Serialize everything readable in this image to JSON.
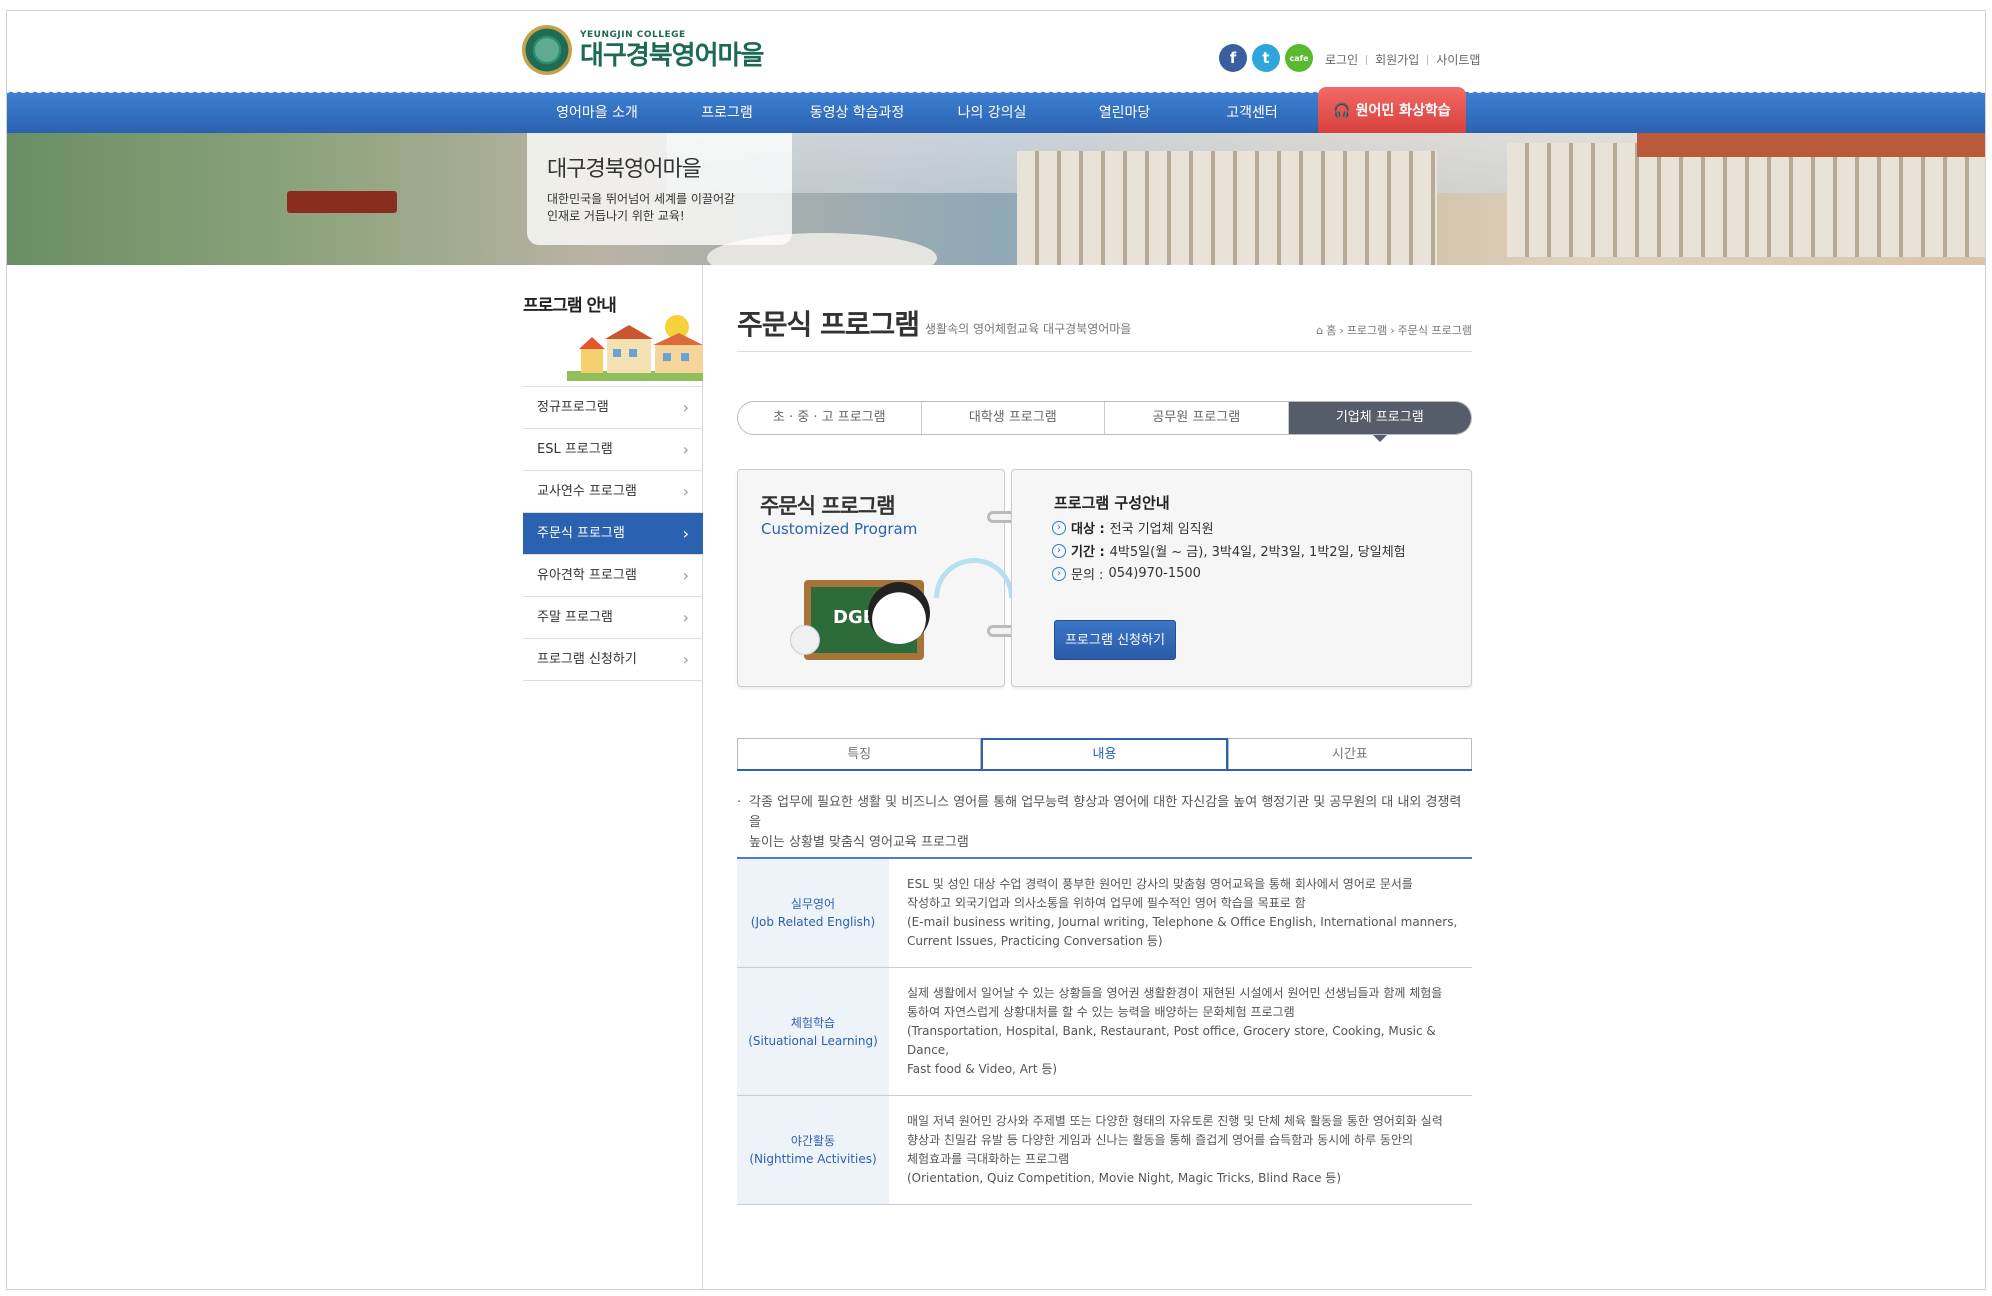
{
  "header": {
    "logo_sub": "YEUNGJIN COLLEGE",
    "logo_main": "대구경북영어마을",
    "social": [
      {
        "name": "facebook-icon",
        "glyph": "f",
        "color": "#3a5fa0"
      },
      {
        "name": "twitter-icon",
        "glyph": "t",
        "color": "#2ea6dd"
      },
      {
        "name": "cafe-icon",
        "glyph": "cafe",
        "color": "#5ab92f"
      }
    ],
    "util": [
      "로그인",
      "회원가입",
      "사이트맵"
    ]
  },
  "gnb": {
    "items": [
      "영어마을 소개",
      "프로그램",
      "동영상 학습과정",
      "나의 강의실",
      "열린마당",
      "고객센터"
    ],
    "live_label": "원어민 화상학습"
  },
  "hero": {
    "title": "대구경북영어마을",
    "line1": "대한민국을 뛰어넘어 세계를 이끌어갈",
    "line2": "인재로 거듭나기 위한 교육!"
  },
  "lnb": {
    "title": "프로그램 안내",
    "items": [
      "정규프로그램",
      "ESL 프로그램",
      "교사연수 프로그램",
      "주문식 프로그램",
      "유아견학 프로그램",
      "주말 프로그램",
      "프로그램 신청하기"
    ],
    "active_index": 3
  },
  "page": {
    "title": "주문식 프로그램",
    "subtitle": "생활속의 영어체험교육 대구경북영어마을",
    "breadcrumb": [
      "홈",
      "프로그램",
      "주문식 프로그램"
    ]
  },
  "program_tabs": [
    "초 · 중 · 고 프로그램",
    "대학생 프로그램",
    "공무원 프로그램",
    "기업체 프로그램"
  ],
  "program_tabs_active": 3,
  "card": {
    "title": "주문식 프로그램",
    "subtitle": "Customized Program",
    "board_text": "DGEV",
    "info_title": "프로그램 구성안내",
    "target_label": "대상 :",
    "target_value": "전국 기업체 임직원",
    "period_label": "기간 :",
    "period_value": "4박5일(월 ~ 금), 3박4일, 2박3일, 1박2일, 당일체험",
    "contact_label": "문의 :",
    "contact_value": "054)970-1500",
    "apply_label": "프로그램 신청하기"
  },
  "content_tabs": [
    "특징",
    "내용",
    "시간표"
  ],
  "content_tabs_active": 1,
  "intro_line1": "각종 업무에 필요한 생활 및 비즈니스 영어를 통해 업무능력 향상과 영어에 대한 자신감을 높여 행정기관 및 공무원의 대 내외 경쟁력을",
  "intro_line2": "높이는 상황별 맞춤식 영어교육 프로그램",
  "features": [
    {
      "name_ko": "실무영어",
      "name_en": "(Job Related English)",
      "lines": [
        "ESL 및 성인 대상 수업 경력이 풍부한 원어민 강사의 맞춤형 영어교육을 통해 회사에서 영어로 문서를",
        "작성하고 외국기업과 의사소통을 위하여 업무에 필수적인 영어 학습을 목표로 함",
        "(E-mail business writing, Journal writing, Telephone & Office English, International manners,",
        "Current Issues, Practicing Conversation 등)"
      ]
    },
    {
      "name_ko": "체험학습",
      "name_en": "(Situational Learning)",
      "lines": [
        "실제 생활에서 일어날 수 있는 상황들을 영어권 생활환경이 재현된 시설에서 원어민 선생님들과 함께 체험을",
        "통하여 자연스럽게 상황대처를 할 수 있는 능력을 배양하는 문화체험 프로그램",
        "(Transportation, Hospital, Bank, Restaurant, Post office, Grocery store, Cooking, Music & Dance,",
        "Fast food & Video, Art 등)"
      ]
    },
    {
      "name_ko": "야간활동",
      "name_en": "(Nighttime Activities)",
      "lines": [
        "매일 저녁 원어민 강사와 주제별 또는 다양한 형태의 자유토론 진행 및 단체 체육 활동을 통한 영어회화 실력",
        "향상과 친밀감 유발 등 다양한 게임과 신나는 활동을 통해 즐겁게 영어를 습득함과 동시에 하루 동안의",
        "체험효과를 극대화하는 프로그램",
        "(Orientation, Quiz Competition, Movie Night, Magic Tricks, Blind Race 등)"
      ]
    }
  ]
}
